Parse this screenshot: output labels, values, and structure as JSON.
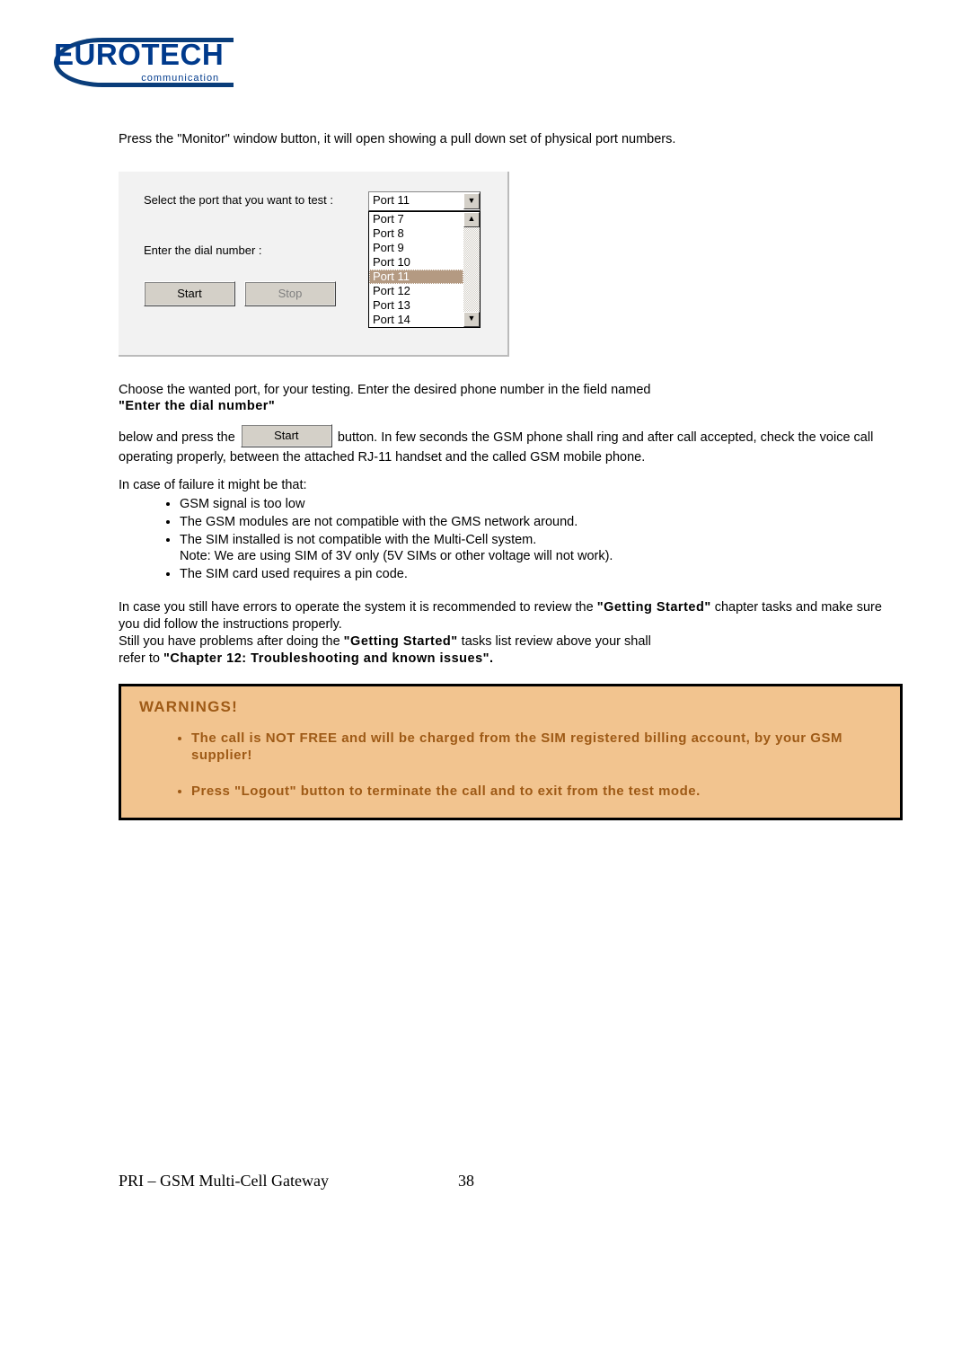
{
  "logo": {
    "brand": "EUROTECH",
    "sub": "communication"
  },
  "intro": "Press the \"Monitor\" window button, it will open showing a pull down set of physical port numbers.",
  "monitor": {
    "select_label": "Select the port that you want to test :",
    "dial_label": "Enter the dial number :",
    "start_label": "Start",
    "stop_label": "Stop",
    "selected_port": "Port 11",
    "ports": [
      "Port 7",
      "Port 8",
      "Port 9",
      "Port 10",
      "Port 11",
      "Port 12",
      "Port 13",
      "Port 14"
    ]
  },
  "para2_a": "Choose the wanted port, for your testing. Enter the desired phone number in the field named ",
  "para2_b": "\"Enter the dial number\"",
  "para3_a": "below and press the ",
  "para3_b": " button. In few seconds the GSM phone shall ring and after call accepted, check the voice call operating properly, between the attached RJ-11 handset and the called GSM mobile phone.",
  "fail_intro": "In case of failure it might be that:",
  "fail_items": [
    "GSM signal is too low",
    "The GSM modules are not compatible with the GMS network around.",
    "The SIM installed is not compatible with the Multi-Cell system.",
    "The SIM card used requires a pin code."
  ],
  "fail_note": "Note: We are using SIM of 3V only (5V SIMs or other voltage will not work).",
  "para4_a": "In case you still have errors to operate the system it is recommended to review the ",
  "para4_b": "\"Getting Started\"",
  "para4_c": " chapter tasks and make sure you did follow the instructions properly.",
  "para5_a": "Still you have problems after doing the ",
  "para5_b": "\"Getting Started\"",
  "para5_c": " tasks list review above your shall",
  "para6_a": "refer to ",
  "para6_b": "\"Chapter 12: Troubleshooting and known issues\".",
  "warning": {
    "title": "WARNINGS!",
    "items": [
      "The call is NOT FREE and will be charged from the SIM registered billing account, by your GSM supplier!",
      "Press \"Logout\" button to terminate the call and to exit from the test mode."
    ]
  },
  "footer": {
    "doc": "PRI – GSM Multi-Cell Gateway",
    "page": "38"
  }
}
